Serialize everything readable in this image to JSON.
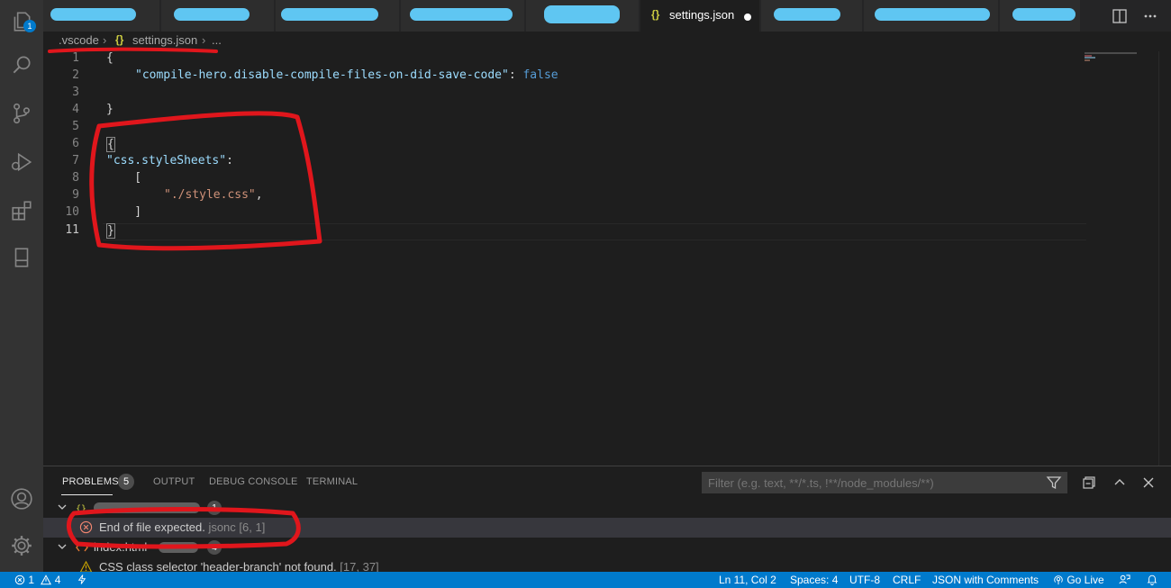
{
  "activity_bar": {
    "explorer_badge": "1",
    "items": [
      "files-icon",
      "search-icon",
      "source-control-icon",
      "run-debug-icon",
      "extensions-icon",
      "remote-explorer-icon"
    ],
    "bottom": [
      "account-icon",
      "manage-gear-icon"
    ]
  },
  "tabs": {
    "active_label": "settings.json",
    "active_icon_text": "{}",
    "redacted_tab_count": 9
  },
  "breadcrumb": {
    "folder": ".vscode",
    "file_icon": "{}",
    "file": "settings.json",
    "more": "..."
  },
  "editor": {
    "lines": [
      {
        "n": "1",
        "text": "{"
      },
      {
        "n": "2",
        "key": "\"compile-hero.disable-compile-files-on-did-save-code\"",
        "sep": ": ",
        "value": "false"
      },
      {
        "n": "3",
        "text": ""
      },
      {
        "n": "4",
        "text": "}"
      },
      {
        "n": "5",
        "text": ""
      },
      {
        "n": "6",
        "text": "{"
      },
      {
        "n": "7",
        "key": "\"css.styleSheets\"",
        "sep": ":"
      },
      {
        "n": "8",
        "text": "    ["
      },
      {
        "n": "9",
        "str": "\"./style.css\"",
        "after": ","
      },
      {
        "n": "10",
        "text": "    ]"
      },
      {
        "n": "11",
        "text": "}"
      }
    ]
  },
  "panel": {
    "tabs": [
      "PROBLEMS",
      "OUTPUT",
      "DEBUG CONSOLE",
      "TERMINAL"
    ],
    "problems_count": "5",
    "filter_placeholder": "Filter (e.g. text, **/*.ts, !**/node_modules/**)",
    "group1_count": "1",
    "problem1_message": "End of file expected.",
    "problem1_source": "jsonc",
    "problem1_location": "[6, 1]",
    "group2_label": "index.html",
    "group2_count": "4",
    "problem2_message": "CSS class selector 'header-branch' not found.",
    "problem2_location": "[17, 37]"
  },
  "status_bar": {
    "errors": "1",
    "warnings": "4",
    "position": "Ln 11, Col 2",
    "spaces": "Spaces: 4",
    "encoding": "UTF-8",
    "eol": "CRLF",
    "language": "JSON with Comments",
    "golive": "Go Live"
  },
  "colors": {
    "accent": "#007acc",
    "annotation": "#e0161c",
    "redaction": "#5fc6f2"
  }
}
